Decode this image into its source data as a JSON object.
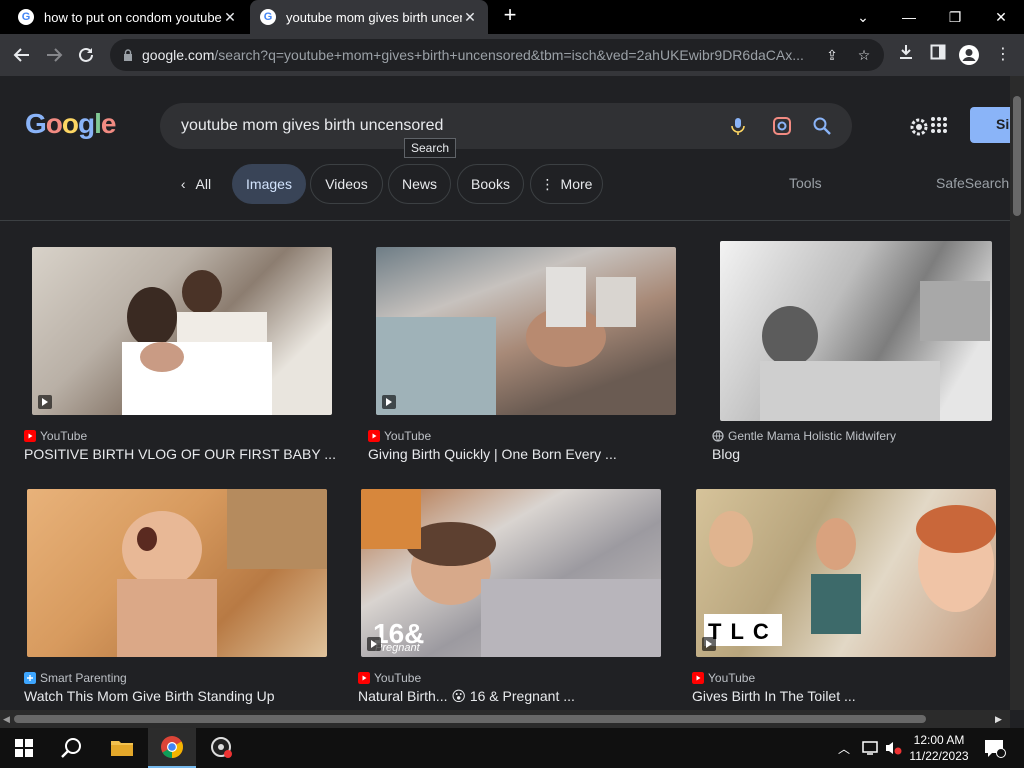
{
  "browser": {
    "tabs": [
      {
        "title": "how to put on condom youtube",
        "active": false
      },
      {
        "title": "youtube mom gives birth uncens",
        "active": true
      }
    ],
    "url_host": "google.com",
    "url_rest": "/search?q=youtube+mom+gives+birth+uncensored&tbm=isch&ved=2ahUKEwibr9DR6daCAx..."
  },
  "search": {
    "query": "youtube mom gives birth uncensored",
    "tooltip": "Search",
    "signin_label": "Si"
  },
  "chips": {
    "all": "All",
    "images": "Images",
    "videos": "Videos",
    "news": "News",
    "books": "Books",
    "more": "More",
    "tools": "Tools",
    "safesearch": "SafeSearch"
  },
  "results": [
    {
      "source": "YouTube",
      "caption": "POSITIVE BIRTH VLOG OF OUR FIRST BABY ...",
      "source_type": "youtube"
    },
    {
      "source": "YouTube",
      "caption": "Giving Birth Quickly | One Born Every ...",
      "source_type": "youtube"
    },
    {
      "source": "Gentle Mama Holistic Midwifery",
      "caption": "Blog",
      "source_type": "web"
    },
    {
      "source": "Smart Parenting",
      "caption": "Watch This Mom Give Birth Standing Up",
      "source_type": "sp"
    },
    {
      "source": "YouTube",
      "caption": "Natural Birth... 😮 16 & Pregnant ...",
      "source_type": "youtube"
    },
    {
      "source": "YouTube",
      "caption": "Gives Birth In The Toilet ...",
      "source_type": "youtube"
    }
  ],
  "thumb_overlays": {
    "mtv_text": "16&",
    "mtv_sub": "Pregnant",
    "tlc_text": "TLC"
  },
  "taskbar": {
    "time": "12:00 AM",
    "date": "11/22/2023"
  },
  "colors": {
    "accent": "#8ab4f8",
    "youtube_red": "#ff0000",
    "page_bg": "#202124"
  }
}
